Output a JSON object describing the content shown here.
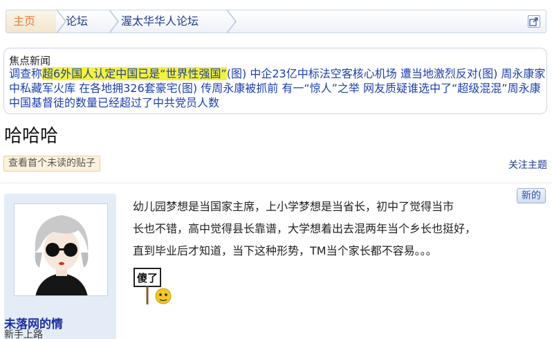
{
  "breadcrumb": {
    "home": "主页",
    "forum": "论坛",
    "board": "渥太华华人论坛"
  },
  "news": {
    "title": "焦点新闻",
    "items": [
      "调查称",
      "超6外国人认定中国已是“世界性强国”",
      "(图)",
      "中企23亿中标法空客核心机场 遭当地激烈反对(图)",
      "周永康家中私藏军火库",
      "在各地拥326套豪宅(图)",
      "传周永康被抓前 有一“惊人”之举",
      "网友质疑谁选中了“超级混混”周永康",
      "中国基督徒的数量已经超过了中共党员人数"
    ]
  },
  "thread": {
    "title": "哈哈哈",
    "first_unread": "查看首个未读的贴子",
    "follow": "关注主题"
  },
  "post": {
    "new_badge": "新的",
    "body_lines": [
      "幼儿园梦想是当国家主席，上小学梦想是当省长，初中了觉得当市",
      "长也不错，高中觉得县长靠谱，大学想着出去混两年当个乡长也挺好，",
      "直到毕业后才知道，当下这种形势，TM当个家长都不容易。。。"
    ],
    "emoticon_text": "傻了"
  },
  "author": {
    "name": "未落网的情",
    "rank": "新手上路"
  },
  "colors": {
    "link": "#1c3fb0",
    "highlight": "#f5f23a",
    "home_crumb": "#e07b3c",
    "author_panel": "#e3ecf7"
  }
}
